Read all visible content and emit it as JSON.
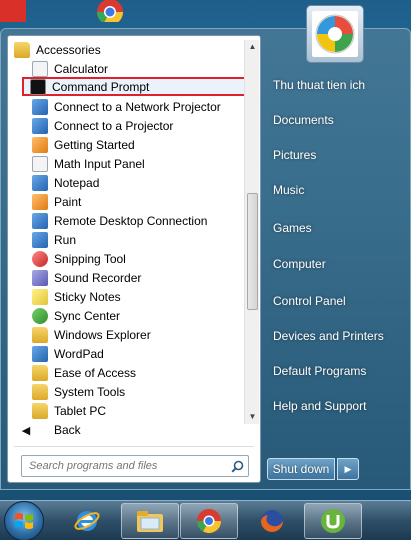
{
  "programs": [
    {
      "label": "Accessories",
      "icon": "folder-icon"
    },
    {
      "label": "Calculator",
      "icon": "calculator-icon"
    },
    {
      "label": "Command Prompt",
      "icon": "command-prompt-icon",
      "selected": true
    },
    {
      "label": "Connect to a Network Projector",
      "icon": "network-projector-icon"
    },
    {
      "label": "Connect to a Projector",
      "icon": "projector-icon"
    },
    {
      "label": "Getting Started",
      "icon": "getting-started-icon"
    },
    {
      "label": "Math Input Panel",
      "icon": "math-input-icon"
    },
    {
      "label": "Notepad",
      "icon": "notepad-icon"
    },
    {
      "label": "Paint",
      "icon": "paint-icon"
    },
    {
      "label": "Remote Desktop Connection",
      "icon": "remote-desktop-icon"
    },
    {
      "label": "Run",
      "icon": "run-icon"
    },
    {
      "label": "Snipping Tool",
      "icon": "snipping-tool-icon"
    },
    {
      "label": "Sound Recorder",
      "icon": "microphone-icon"
    },
    {
      "label": "Sticky Notes",
      "icon": "sticky-notes-icon"
    },
    {
      "label": "Sync Center",
      "icon": "sync-center-icon"
    },
    {
      "label": "Windows Explorer",
      "icon": "explorer-icon"
    },
    {
      "label": "WordPad",
      "icon": "wordpad-icon"
    },
    {
      "label": "Ease of Access",
      "icon": "folder-icon"
    },
    {
      "label": "System Tools",
      "icon": "folder-icon"
    },
    {
      "label": "Tablet PC",
      "icon": "folder-icon"
    }
  ],
  "back_label": "Back",
  "search": {
    "placeholder": "Search programs and files"
  },
  "right_items": [
    "Thu thuat tien ich",
    "Documents",
    "Pictures",
    "Music",
    "Games",
    "Computer",
    "Control Panel",
    "Devices and Printers",
    "Default Programs",
    "Help and Support"
  ],
  "shutdown_label": "Shut down",
  "taskbar": {
    "pinned": [
      "internet-explorer-icon",
      "file-explorer-icon",
      "chrome-icon",
      "firefox-icon",
      "utorrent-icon"
    ]
  },
  "colors": {
    "selection_border": "#e0202a",
    "menu_bg": "#46789a"
  }
}
